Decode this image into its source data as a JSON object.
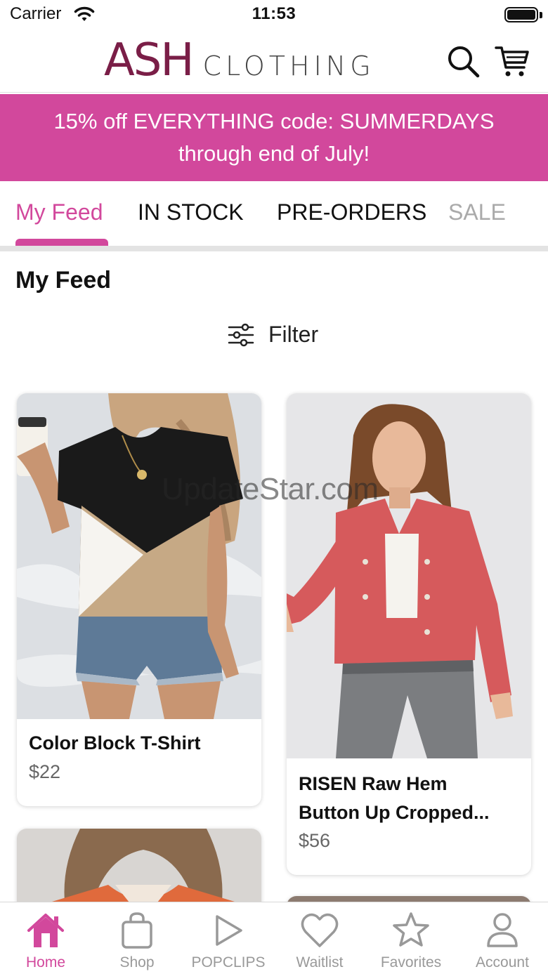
{
  "status_bar": {
    "carrier": "Carrier",
    "time": "11:53"
  },
  "header": {
    "logo_primary": "ASH",
    "logo_secondary": "CLOTHING",
    "search_icon": "search-icon",
    "cart_icon": "cart-icon"
  },
  "promo": {
    "line1": "15% off EVERYTHING code: SUMMERDAYS",
    "line2": "through end of July!"
  },
  "tabs": [
    {
      "label": "My Feed",
      "active": true
    },
    {
      "label": "IN STOCK",
      "active": false
    },
    {
      "label": "PRE-ORDERS",
      "active": false
    },
    {
      "label": "SALE",
      "active": false
    }
  ],
  "feed": {
    "title": "My Feed",
    "filter_label": "Filter",
    "products": [
      {
        "name": "Color Block T-Shirt",
        "price": "$22"
      },
      {
        "name_line1": "RISEN Raw Hem",
        "name_line2": "Button Up Cropped...",
        "price": "$56"
      }
    ]
  },
  "watermark": "UpdateStar.com",
  "bottom_nav": [
    {
      "label": "Home",
      "icon": "home-icon",
      "active": true
    },
    {
      "label": "Shop",
      "icon": "shopping-bag-icon",
      "active": false
    },
    {
      "label": "POPCLIPS",
      "icon": "play-icon",
      "active": false
    },
    {
      "label": "Waitlist",
      "icon": "heart-icon",
      "active": false
    },
    {
      "label": "Favorites",
      "icon": "star-icon",
      "active": false
    },
    {
      "label": "Account",
      "icon": "user-icon",
      "active": false
    }
  ],
  "colors": {
    "brand_pink": "#d2489c",
    "logo_plum": "#7a1e47",
    "inactive_gray": "#999999"
  }
}
